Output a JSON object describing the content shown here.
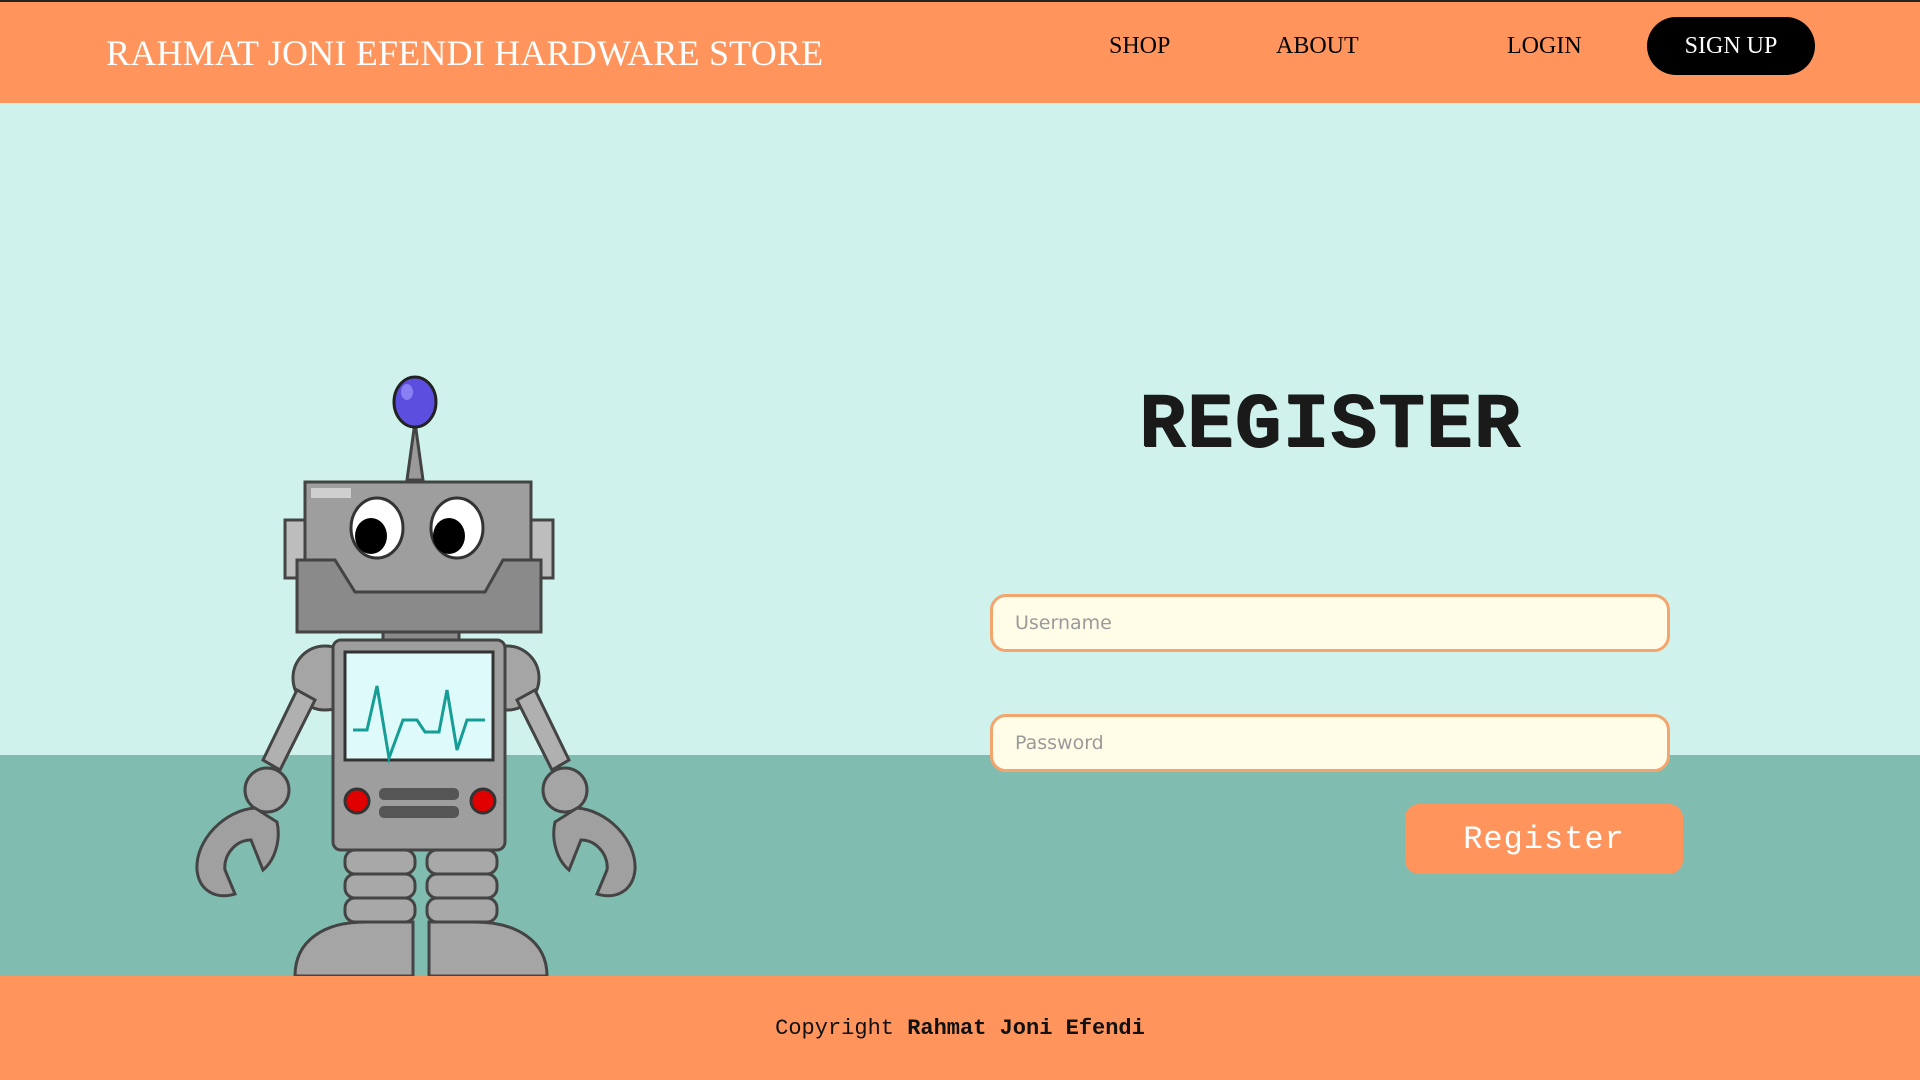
{
  "header": {
    "brand": "RAHMAT JONI EFENDI HARDWARE STORE",
    "nav": {
      "shop": "SHOP",
      "about": "ABOUT",
      "login": "LOGIN",
      "signup": "SIGN UP"
    }
  },
  "form": {
    "title": "REGISTER",
    "username_placeholder": "Username",
    "password_placeholder": "Password",
    "submit_label": "Register"
  },
  "footer": {
    "prefix": "Copyright",
    "author": "Rahmat Joni Efendi"
  },
  "colors": {
    "header_bg": "#FF955D",
    "page_bg": "#CFF3EC",
    "ground": "#80BCB0",
    "field_bg": "#FFFDE8",
    "field_border": "#F4A56E",
    "signup_bg": "#000000"
  },
  "illustration": {
    "name": "robot-illustration"
  }
}
